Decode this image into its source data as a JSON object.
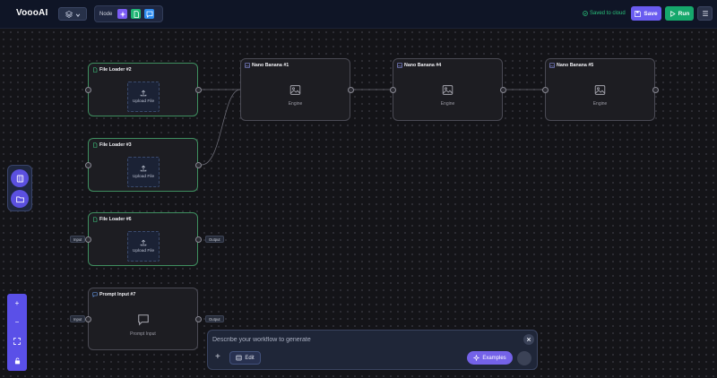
{
  "app": {
    "title": "VoooAI"
  },
  "toolbar": {
    "node_label": "Node",
    "saved_status": "Saved to cloud",
    "save_label": "Save",
    "run_label": "Run"
  },
  "colors": {
    "accent": "#6a5cf0",
    "run": "#16a86c",
    "saved": "#29c07a",
    "node_border_active": "#3f8f60"
  },
  "nodes": {
    "file_loader_2": {
      "title": "File Loader #2",
      "action": "Upload File"
    },
    "file_loader_3": {
      "title": "File Loader #3",
      "action": "Upload File"
    },
    "file_loader_6": {
      "title": "File Loader #6",
      "action": "Upload File",
      "input_tag": "Input",
      "output_tag": "Output"
    },
    "prompt_input_7": {
      "title": "Prompt Input #7",
      "caption": "Prompt Input",
      "input_tag": "Input",
      "output_tag": "Output"
    },
    "nano_banana_1": {
      "title": "Nano Banana #1",
      "caption": "Engine"
    },
    "nano_banana_4": {
      "title": "Nano Banana #4",
      "caption": "Engine"
    },
    "nano_banana_5": {
      "title": "Nano Banana #5",
      "caption": "Engine"
    }
  },
  "zoom_controls": {
    "zoom_in": "+",
    "zoom_out": "−"
  },
  "prompt": {
    "placeholder": "Describe your workflow to generate",
    "add": "+",
    "edit_label": "Edit",
    "examples_label": "Examples"
  }
}
